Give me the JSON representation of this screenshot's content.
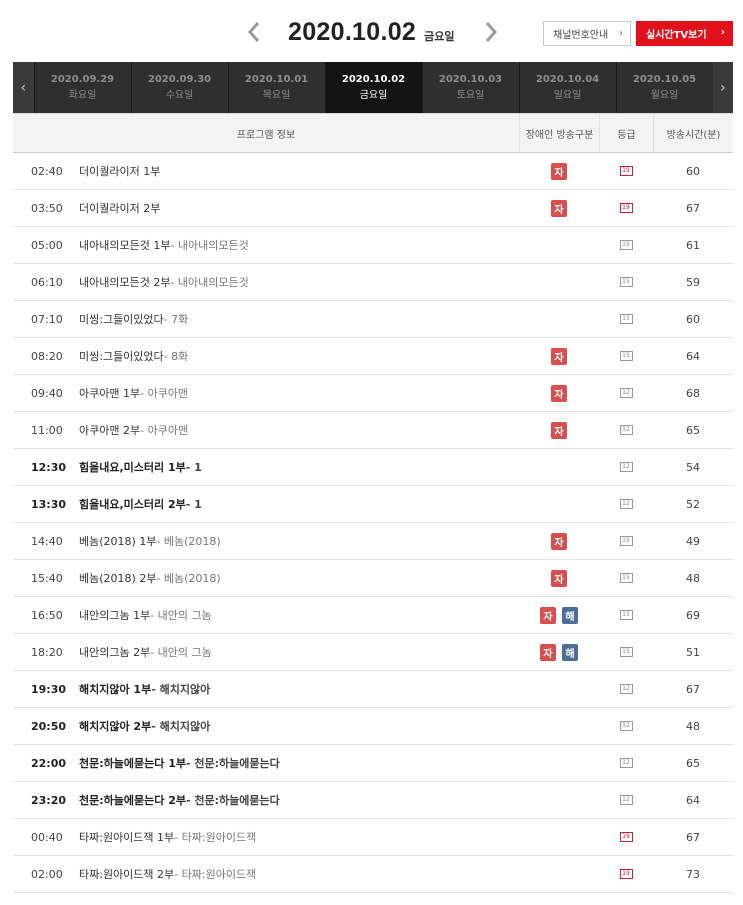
{
  "header": {
    "date": "2020.10.02",
    "day_of_week": "금요일",
    "channel_guide_label": "채널번호안내",
    "live_tv_label": "실시간TV보기"
  },
  "day_tabs": [
    {
      "date": "2020.09.29",
      "dow": "화요일",
      "active": false
    },
    {
      "date": "2020.09.30",
      "dow": "수요일",
      "active": false
    },
    {
      "date": "2020.10.01",
      "dow": "목요일",
      "active": false
    },
    {
      "date": "2020.10.02",
      "dow": "금요일",
      "active": true
    },
    {
      "date": "2020.10.03",
      "dow": "토요일",
      "active": false
    },
    {
      "date": "2020.10.04",
      "dow": "일요일",
      "active": false
    },
    {
      "date": "2020.10.05",
      "dow": "월요일",
      "active": false
    }
  ],
  "table": {
    "headers": {
      "program": "프로그램 정보",
      "accessibility": "장애인 방송구분",
      "grade": "등급",
      "duration": "방송시간(분)"
    },
    "badge_labels": {
      "ja": "자",
      "hae": "해"
    },
    "rows": [
      {
        "time": "02:40",
        "title": "더이퀄라이저 1부",
        "subtitle": "",
        "badges": [
          "ja"
        ],
        "grade": "19",
        "duration": "60",
        "bold": false
      },
      {
        "time": "03:50",
        "title": "더이퀄라이저 2부",
        "subtitle": "",
        "badges": [
          "ja"
        ],
        "grade": "19",
        "duration": "67",
        "bold": false
      },
      {
        "time": "05:00",
        "title": "내아내의모든것 1부",
        "subtitle": " - 내아내의모든것",
        "badges": [],
        "grade": "15",
        "duration": "61",
        "bold": false
      },
      {
        "time": "06:10",
        "title": "내아내의모든것 2부",
        "subtitle": " - 내아내의모든것",
        "badges": [],
        "grade": "15",
        "duration": "59",
        "bold": false
      },
      {
        "time": "07:10",
        "title": "미씽:그들이있었다",
        "subtitle": " - 7화",
        "badges": [],
        "grade": "15",
        "duration": "60",
        "bold": false
      },
      {
        "time": "08:20",
        "title": "미씽:그들이있었다",
        "subtitle": " - 8화",
        "badges": [
          "ja"
        ],
        "grade": "15",
        "duration": "64",
        "bold": false
      },
      {
        "time": "09:40",
        "title": "아쿠아맨 1부",
        "subtitle": " - 아쿠아맨",
        "badges": [
          "ja"
        ],
        "grade": "12",
        "duration": "68",
        "bold": false
      },
      {
        "time": "11:00",
        "title": "아쿠아맨 2부",
        "subtitle": " - 아쿠아맨",
        "badges": [
          "ja"
        ],
        "grade": "12",
        "duration": "65",
        "bold": false
      },
      {
        "time": "12:30",
        "title": "힘을내요,미스터리 1부",
        "subtitle": " - 1",
        "badges": [],
        "grade": "12",
        "duration": "54",
        "bold": true
      },
      {
        "time": "13:30",
        "title": "힘을내요,미스터리 2부",
        "subtitle": " - 1",
        "badges": [],
        "grade": "12",
        "duration": "52",
        "bold": true
      },
      {
        "time": "14:40",
        "title": "베놈(2018) 1부",
        "subtitle": " - 베놈(2018)",
        "badges": [
          "ja"
        ],
        "grade": "15",
        "duration": "49",
        "bold": false
      },
      {
        "time": "15:40",
        "title": "베놈(2018) 2부",
        "subtitle": " - 베놈(2018)",
        "badges": [
          "ja"
        ],
        "grade": "15",
        "duration": "48",
        "bold": false
      },
      {
        "time": "16:50",
        "title": "내안의그놈 1부",
        "subtitle": " - 내안의 그놈",
        "badges": [
          "ja",
          "hae"
        ],
        "grade": "15",
        "duration": "69",
        "bold": false
      },
      {
        "time": "18:20",
        "title": "내안의그놈 2부",
        "subtitle": " - 내안의 그놈",
        "badges": [
          "ja",
          "hae"
        ],
        "grade": "15",
        "duration": "51",
        "bold": false
      },
      {
        "time": "19:30",
        "title": "해치지않아 1부",
        "subtitle": " - 해치지않아",
        "badges": [],
        "grade": "12",
        "duration": "67",
        "bold": true
      },
      {
        "time": "20:50",
        "title": "해치지않아 2부",
        "subtitle": " - 해치지않아",
        "badges": [],
        "grade": "12",
        "duration": "48",
        "bold": true
      },
      {
        "time": "22:00",
        "title": "천문:하늘에묻는다 1부",
        "subtitle": " - 천문:하늘에묻는다",
        "badges": [],
        "grade": "12",
        "duration": "65",
        "bold": true
      },
      {
        "time": "23:20",
        "title": "천문:하늘에묻는다 2부",
        "subtitle": " - 천문:하늘에묻는다",
        "badges": [],
        "grade": "12",
        "duration": "64",
        "bold": true
      },
      {
        "time": "00:40",
        "title": "타짜:원아이드잭 1부",
        "subtitle": " - 타짜:원아이드잭",
        "badges": [],
        "grade": "19",
        "duration": "67",
        "bold": false
      },
      {
        "time": "02:00",
        "title": "타짜:원아이드잭 2부",
        "subtitle": " - 타짜:원아이드잭",
        "badges": [],
        "grade": "19",
        "duration": "73",
        "bold": false
      }
    ]
  }
}
